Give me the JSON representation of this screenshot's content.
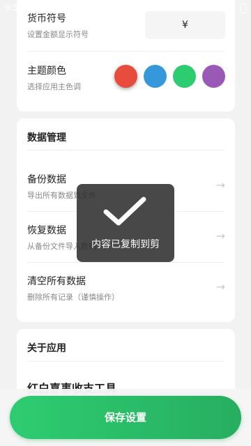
{
  "status_bar": {
    "time": "9:5"
  },
  "display_card": {
    "currency": {
      "title": "货币符号",
      "subtitle": "设置金额显示符号",
      "value": "¥"
    },
    "theme": {
      "title": "主题颜色",
      "subtitle": "选择应用主色调",
      "colors": [
        {
          "name": "red",
          "hex": "#e74c3c",
          "selected": true
        },
        {
          "name": "blue",
          "hex": "#3498db",
          "selected": false
        },
        {
          "name": "green",
          "hex": "#2ecc71",
          "selected": false
        },
        {
          "name": "purple",
          "hex": "#9b59b6",
          "selected": false
        }
      ]
    }
  },
  "data_management": {
    "section_title": "数据管理",
    "items": [
      {
        "title": "备份数据",
        "subtitle": "导出所有数据到文件"
      },
      {
        "title": "恢复数据",
        "subtitle": "从备份文件导入数据"
      },
      {
        "title": "清空所有数据",
        "subtitle": "删除所有记录（谨慎操作）"
      }
    ],
    "arrow_glyph": "→"
  },
  "about": {
    "section_title": "关于应用",
    "app_name": "红白喜事收支工具"
  },
  "save_button": {
    "label": "保存设置"
  },
  "toast": {
    "message": "内容已复制到剪",
    "icon": "checkmark-icon"
  }
}
